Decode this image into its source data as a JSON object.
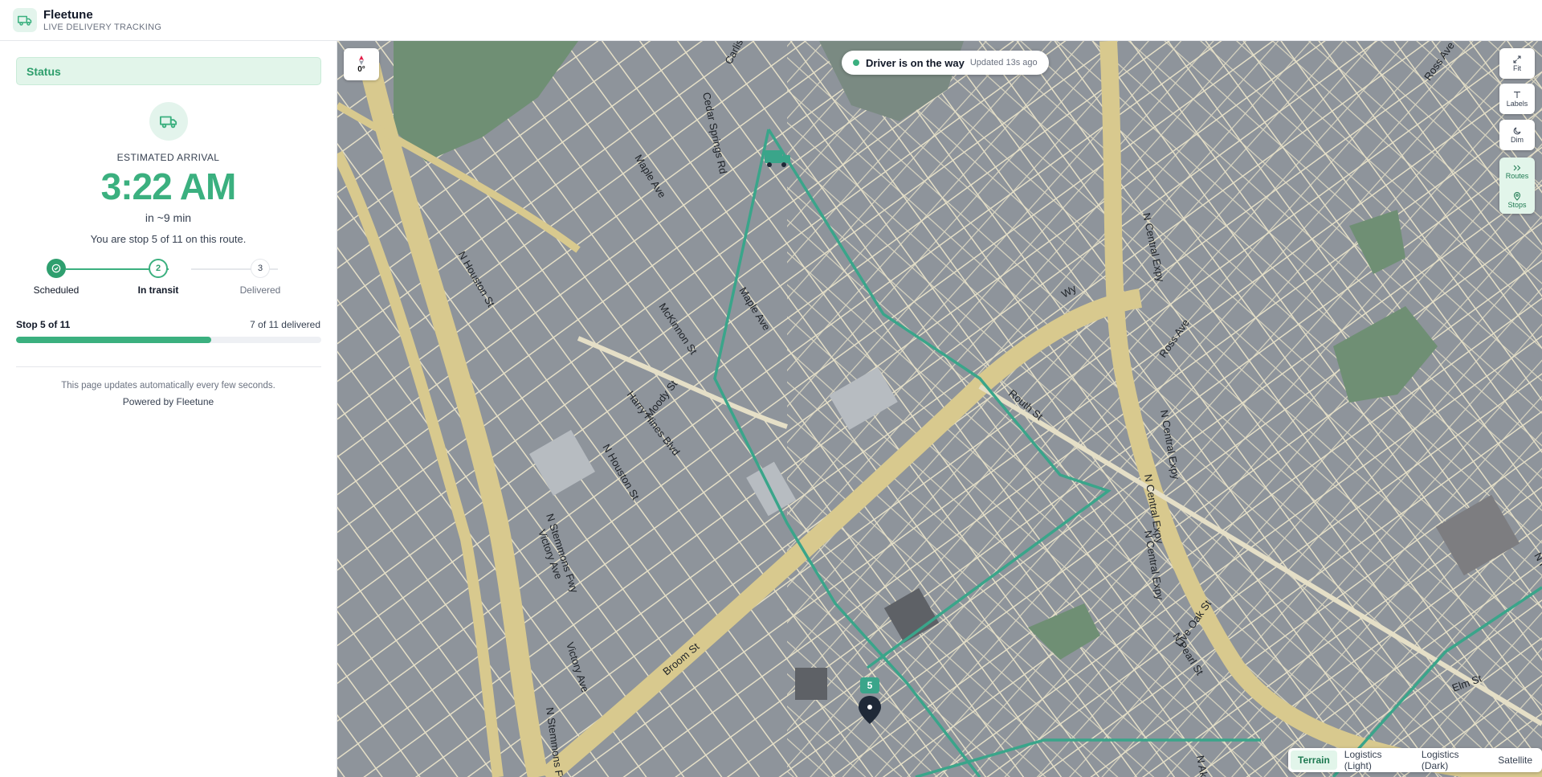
{
  "header": {
    "brand": "Fleetune",
    "subtitle": "LIVE DELIVERY TRACKING"
  },
  "sidebar": {
    "status_label": "Status",
    "eta_label": "ESTIMATED ARRIVAL",
    "eta_time": "3:22 AM",
    "eta_relative": "in ~9 min",
    "stop_line": "You are stop 5 of 11 on this route.",
    "steps": [
      {
        "number": "",
        "label": "Scheduled",
        "state": "done"
      },
      {
        "number": "2",
        "label": "In transit",
        "state": "current"
      },
      {
        "number": "3",
        "label": "Delivered",
        "state": "pending"
      }
    ],
    "progress_left": "Stop 5 of 11",
    "progress_right": "7 of 11 delivered",
    "progress_fraction": 0.64,
    "footer_note": "This page updates automatically every few seconds.",
    "powered_by": "Powered by Fleetune"
  },
  "map": {
    "compass_value": "0°",
    "status_pill_main": "Driver is on the way",
    "status_pill_sub": "Updated 13s ago",
    "controls": {
      "fit": "Fit",
      "labels": "Labels",
      "dim": "Dim",
      "routes": "Routes",
      "stops": "Stops"
    },
    "stop_marker_number": "5",
    "styles": [
      {
        "label": "Terrain",
        "active": true
      },
      {
        "label": "Logistics (Light)",
        "active": false
      },
      {
        "label": "Logistics (Dark)",
        "active": false
      },
      {
        "label": "Satellite",
        "active": false
      }
    ],
    "street_labels": [
      "Cedar Springs Rd",
      "Carlisle St",
      "Maple Ave",
      "Maple Ave",
      "N Houston St",
      "McKinnon St",
      "Harry Hines Blvd",
      "Moody St",
      "N Houston St",
      "N Stemmons Fwy",
      "Victory Ave",
      "Victory Ave",
      "Broom St",
      "N Stemmons Fwy",
      "N Central Expy",
      "N Central Expy",
      "N Central Expy",
      "N Central Expy",
      "Ross Ave",
      "Ross Ave",
      "Live Oak St",
      "N Pearl St",
      "N Akard",
      "Elm St",
      "N Hall St",
      "Routh St",
      "Wy"
    ],
    "colors": {
      "accent": "#3bb07f",
      "route": "#3aa58a",
      "highway": "#d8c98e",
      "road": "#e5dfc7",
      "block": "#8e949b",
      "park": "#6f8f74"
    }
  }
}
